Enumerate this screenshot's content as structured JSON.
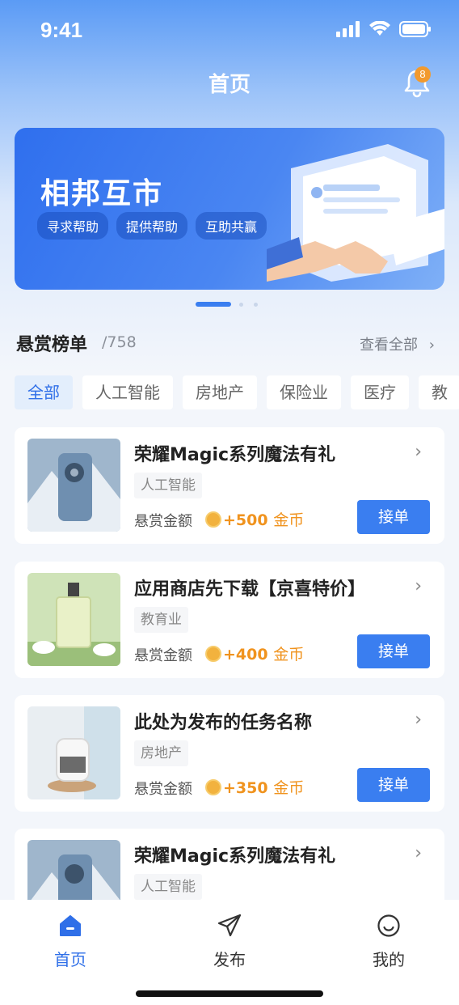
{
  "status": {
    "time": "9:41"
  },
  "header": {
    "title": "首页",
    "badge_count": "8"
  },
  "banner": {
    "title": "相邦互市",
    "tags": [
      "寻求帮助",
      "提供帮助",
      "互助共赢"
    ]
  },
  "section": {
    "title": "悬赏榜单",
    "count": "/758",
    "view_all": "查看全部"
  },
  "categories": [
    "全部",
    "人工智能",
    "房地产",
    "保险业",
    "医疗",
    "教"
  ],
  "tasks": [
    {
      "title": "荣耀Magic系列魔法有礼",
      "tag": "人工智能",
      "reward_label": "悬赏金额",
      "reward_amount": "+500",
      "reward_unit": "金币",
      "button": "接单"
    },
    {
      "title": "应用商店先下载【京喜特价】",
      "tag": "教育业",
      "reward_label": "悬赏金额",
      "reward_amount": "+400",
      "reward_unit": "金币",
      "button": "接单"
    },
    {
      "title": "此处为发布的任务名称",
      "tag": "房地产",
      "reward_label": "悬赏金额",
      "reward_amount": "+350",
      "reward_unit": "金币",
      "button": "接单"
    },
    {
      "title": "荣耀Magic系列魔法有礼",
      "tag": "人工智能"
    }
  ],
  "tab_bar": [
    {
      "label": "首页",
      "icon": "home-icon",
      "active": true
    },
    {
      "label": "发布",
      "icon": "paper-plane-icon",
      "active": false
    },
    {
      "label": "我的",
      "icon": "smile-face-icon",
      "active": false
    }
  ],
  "colors": {
    "accent": "#3a7ef0",
    "reward": "#f0931e",
    "badge": "#f29a2e"
  }
}
